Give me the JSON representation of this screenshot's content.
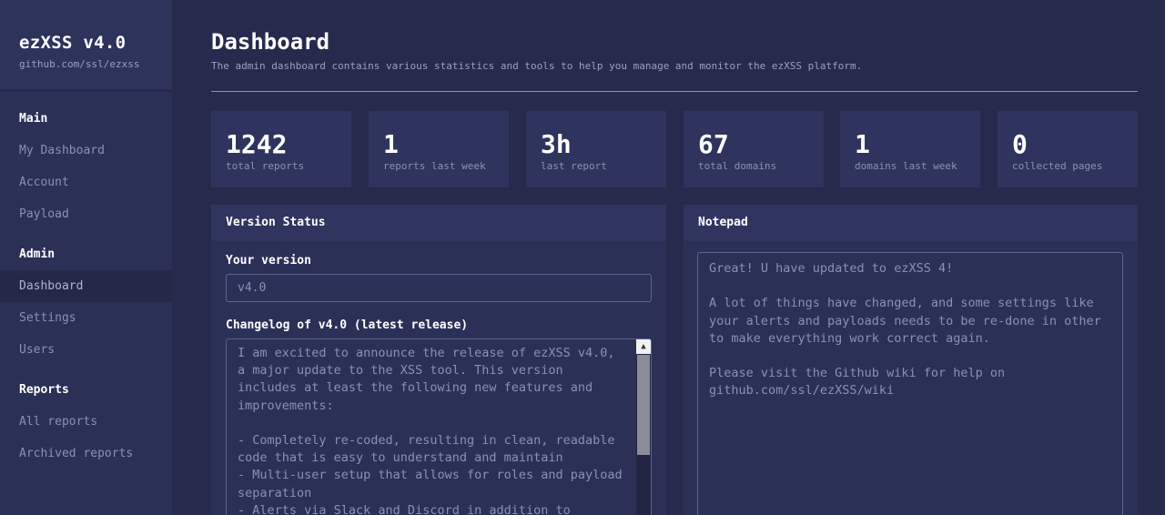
{
  "sidebar": {
    "brand_title": "ezXSS v4.0",
    "brand_sub": "github.com/ssl/ezxss",
    "sections": [
      {
        "title": "Main",
        "items": [
          "My Dashboard",
          "Account",
          "Payload"
        ]
      },
      {
        "title": "Admin",
        "items": [
          "Dashboard",
          "Settings",
          "Users"
        ]
      },
      {
        "title": "Reports",
        "items": [
          "All reports",
          "Archived reports"
        ]
      }
    ],
    "active_item": "Dashboard"
  },
  "header": {
    "title": "Dashboard",
    "description": "The admin dashboard contains various statistics and tools to help you manage and monitor the ezXSS platform."
  },
  "stats": [
    {
      "value": "1242",
      "label": "total reports"
    },
    {
      "value": "1",
      "label": "reports last week"
    },
    {
      "value": "3h",
      "label": "last report"
    },
    {
      "value": "67",
      "label": "total domains"
    },
    {
      "value": "1",
      "label": "domains last week"
    },
    {
      "value": "0",
      "label": "collected pages"
    }
  ],
  "version_panel": {
    "title": "Version Status",
    "your_version_label": "Your version",
    "your_version_value": "v4.0",
    "changelog_label": "Changelog of v4.0 (latest release)",
    "changelog_text": "I am excited to announce the release of ezXSS v4.0,\na major update to the XSS tool. This version\nincludes at least the following new features and\nimprovements:\n\n- Completely re-coded, resulting in clean, readable\ncode that is easy to understand and maintain\n- Multi-user setup that allows for roles and payload\nseparation\n- Alerts via Slack and Discord in addition to"
  },
  "notepad_panel": {
    "title": "Notepad",
    "text": "Great! U have updated to ezXSS 4!\n\nA lot of things have changed, and some settings like\nyour alerts and payloads needs to be re-done in other\nto make everything work correct again.\n\nPlease visit the Github wiki for help on\ngithub.com/ssl/ezXSS/wiki"
  },
  "colors": {
    "background": "#262a4d",
    "sidebar": "#2b3057",
    "card": "#2f345e",
    "muted_text": "#8b90b4"
  }
}
